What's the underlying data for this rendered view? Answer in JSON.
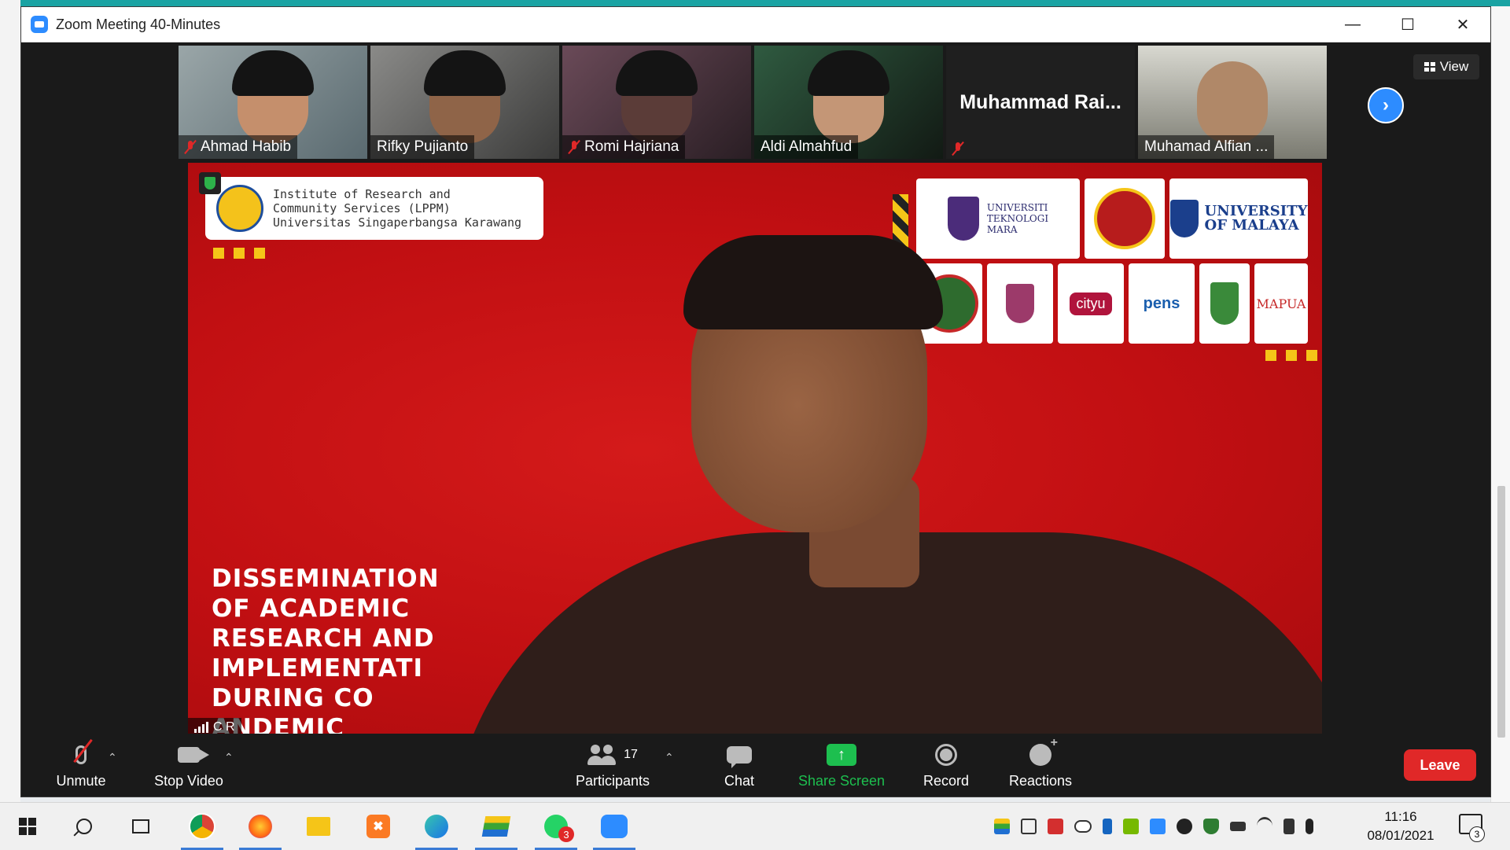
{
  "window": {
    "title": "Zoom Meeting 40-Minutes",
    "controls": [
      "minimize-icon",
      "maximize-icon",
      "close-icon"
    ]
  },
  "participants_strip": [
    {
      "name": "Ahmad Habib",
      "muted": true,
      "video": true
    },
    {
      "name": "Rifky Pujianto",
      "muted": false,
      "video": true
    },
    {
      "name": "Romi Hajriana",
      "muted": true,
      "video": true
    },
    {
      "name": "Aldi Almahfud",
      "muted": false,
      "video": true
    },
    {
      "name": "Muhammad  Rai...",
      "muted": true,
      "video": false
    },
    {
      "name": "Muhamad Alfian ...",
      "muted": false,
      "video": true
    }
  ],
  "view_button": {
    "label": "View"
  },
  "main_video": {
    "speaker_name": "C R",
    "slide": {
      "org_lines": "Institute of Research and\nCommunity Services (LPPM)\nUniversitas Singaperbangsa Karawang",
      "headline": "DISSEMINATION\nOF ACADEMIC\nRESEARCH AND\nIMPLEMENTATI\nDURING CO\nANDEMIC",
      "partners": {
        "uitm": "UNIVERSITI\nTEKNOLOGI\nMARA",
        "malaya": "UNIVERSITY\nOF MALAYA",
        "cityu": "cityu",
        "pens": "pens",
        "mapua": "MAPUA"
      }
    }
  },
  "toolbar": {
    "unmute": "Unmute",
    "stop_video": "Stop Video",
    "participants": "Participants",
    "participants_count": "17",
    "chat": "Chat",
    "share_screen": "Share Screen",
    "record": "Record",
    "reactions": "Reactions",
    "leave": "Leave"
  },
  "taskbar": {
    "whatsapp_badge": "3",
    "time": "11:16",
    "date": "08/01/2021",
    "notification_count": "3"
  },
  "colors": {
    "zoom_blue": "#2d8cff",
    "leave_red": "#e02828",
    "share_green": "#1dbf4f",
    "slide_red": "#c10f12"
  }
}
